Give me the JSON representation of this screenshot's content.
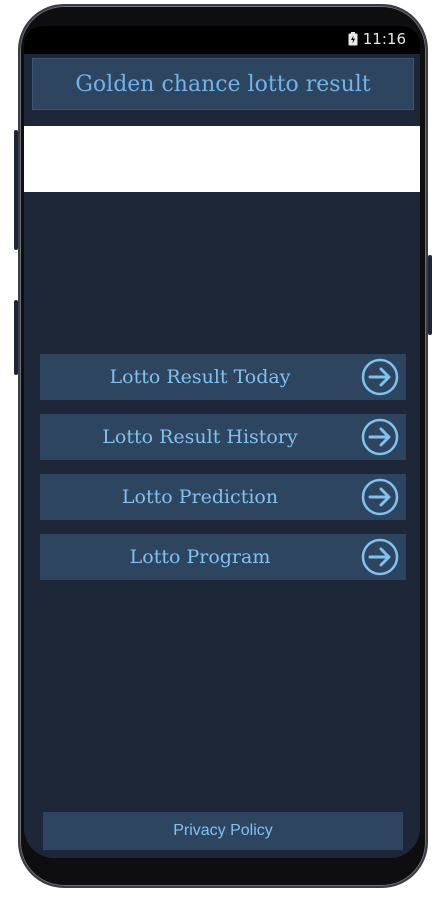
{
  "status_bar": {
    "time": "11:16"
  },
  "header": {
    "title": "Golden chance lotto result"
  },
  "menu": {
    "items": [
      {
        "label": "Lotto Result Today",
        "icon": "arrow-right-circle-icon"
      },
      {
        "label": "Lotto Result History",
        "icon": "arrow-right-circle-icon"
      },
      {
        "label": "Lotto Prediction",
        "icon": "arrow-right-circle-icon"
      },
      {
        "label": "Lotto Program",
        "icon": "arrow-right-circle-icon"
      }
    ]
  },
  "footer": {
    "privacy_label": "Privacy Policy"
  },
  "colors": {
    "background": "#1d2738",
    "button": "#2e4560",
    "text_accent": "#7fc2f0"
  }
}
